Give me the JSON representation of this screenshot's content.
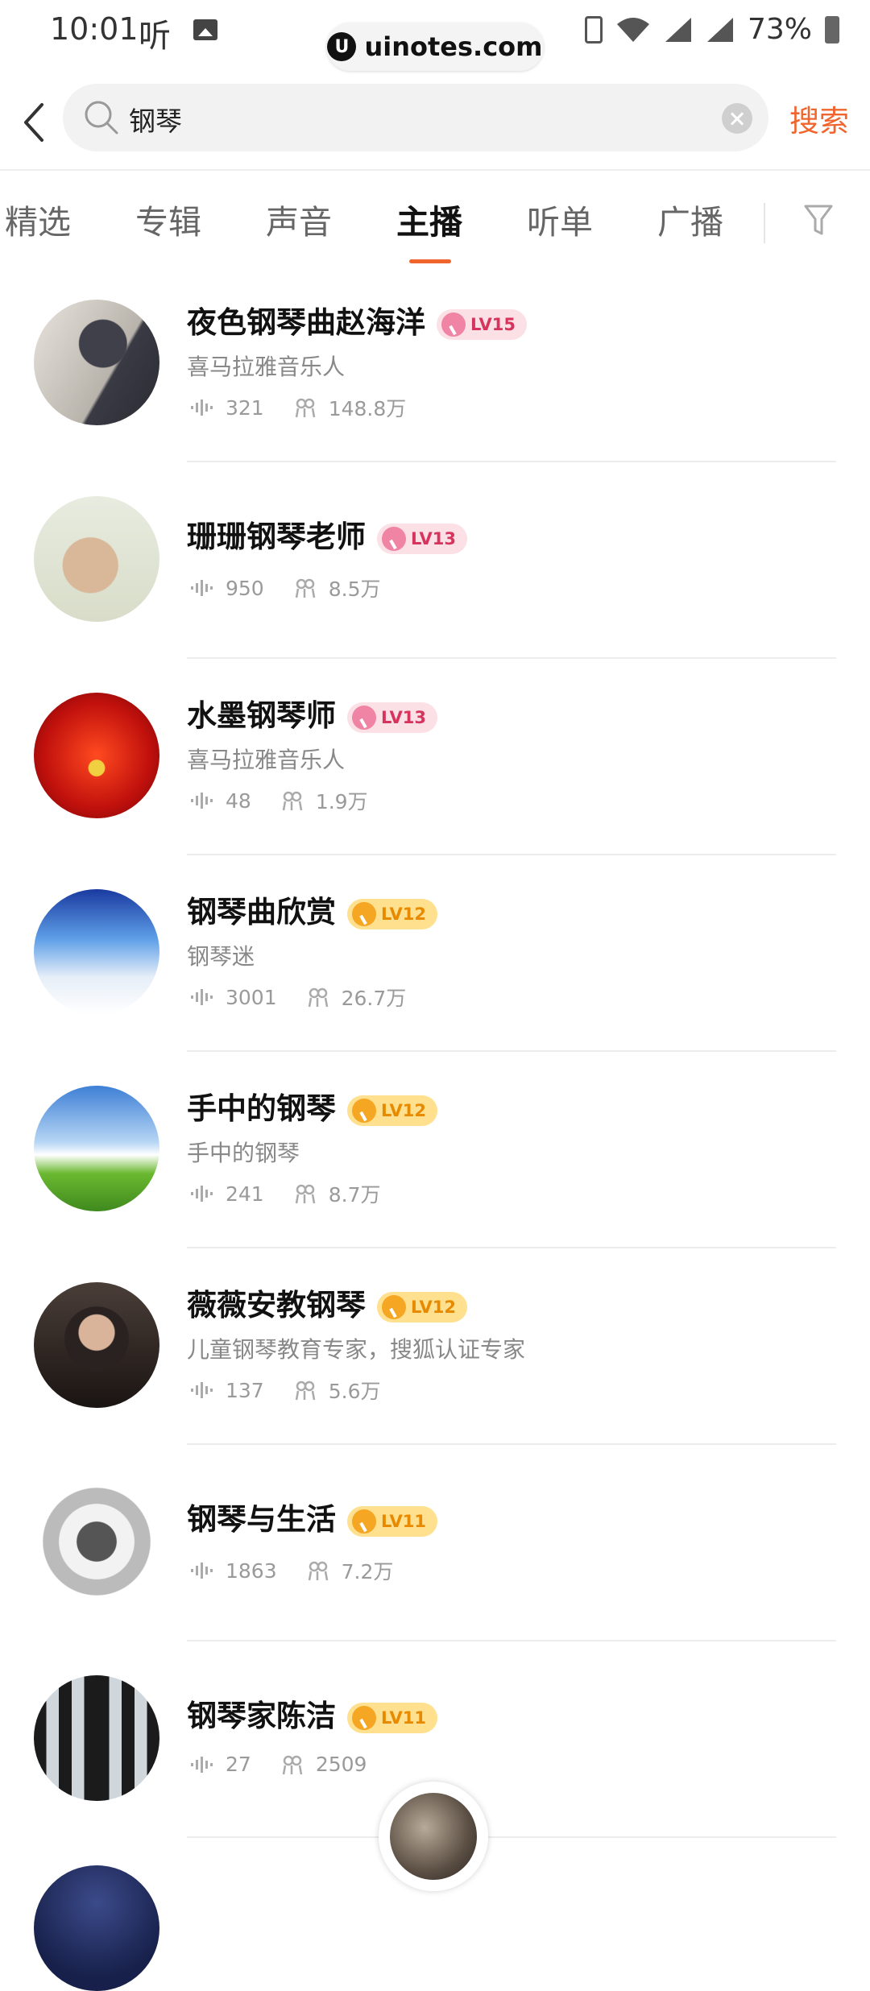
{
  "status_bar": {
    "time": "10:01",
    "ting": "听",
    "watermark": "uinotes.com",
    "watermark_logo": "U",
    "battery": "73%"
  },
  "search": {
    "query": "钢琴",
    "button": "搜索"
  },
  "tabs": {
    "items": [
      "精选",
      "专辑",
      "声音",
      "主播",
      "听单",
      "广播"
    ],
    "active": "主播"
  },
  "anchors": [
    {
      "name": "夜色钢琴曲赵海洋",
      "level": "LV15",
      "badge": "pink",
      "desc": "喜马拉雅音乐人",
      "tracks": "321",
      "fans": "148.8万",
      "avatar_icon": "pianist-photo-icon"
    },
    {
      "name": "珊珊钢琴老师",
      "level": "LV13",
      "badge": "pink",
      "desc": "",
      "tracks": "950",
      "fans": "8.5万",
      "avatar_icon": "hands-photo-icon"
    },
    {
      "name": "水墨钢琴师",
      "level": "LV13",
      "badge": "pink",
      "desc": "喜马拉雅音乐人",
      "tracks": "48",
      "fans": "1.9万",
      "avatar_icon": "red-abstract-icon"
    },
    {
      "name": "钢琴曲欣赏",
      "level": "LV12",
      "badge": "gold",
      "desc": "钢琴迷",
      "tracks": "3001",
      "fans": "26.7万",
      "avatar_icon": "sky-piano-icon"
    },
    {
      "name": "手中的钢琴",
      "level": "LV12",
      "badge": "gold",
      "desc": "手中的钢琴",
      "tracks": "241",
      "fans": "8.7万",
      "avatar_icon": "piano-house-icon"
    },
    {
      "name": "薇薇安教钢琴",
      "level": "LV12",
      "badge": "gold",
      "desc": "儿童钢琴教育专家，搜狐认证专家",
      "tracks": "137",
      "fans": "5.6万",
      "avatar_icon": "woman-portrait-icon"
    },
    {
      "name": "钢琴与生活",
      "level": "LV11",
      "badge": "gold",
      "desc": "",
      "tracks": "1863",
      "fans": "7.2万",
      "avatar_icon": "coffee-cup-icon"
    },
    {
      "name": "钢琴家陈洁",
      "level": "LV11",
      "badge": "gold",
      "desc": "",
      "tracks": "27",
      "fans": "2509",
      "avatar_icon": "pianist-woman-icon"
    }
  ],
  "colors": {
    "accent": "#f0642d",
    "badge_pink_bg": "#fbe0e6",
    "badge_gold_bg": "#ffe08f"
  }
}
